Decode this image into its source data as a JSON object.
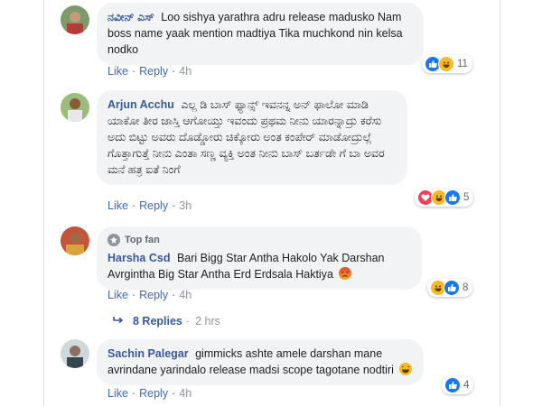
{
  "comments": [
    {
      "name": "ನವೀನ್ ಎಸ್",
      "text": "Loo sishya yarathra adru release madusko Nam boss name yaak mention madtiya Tika muchkond nin kelsa nodko",
      "reaction_count": "11",
      "time": "4h"
    },
    {
      "name": "Arjun Acchu",
      "text": "ಎಲ್ಲ ಡಿ ಬಾಸ್ ಫ್ಯಾನ್ಸ್ ಇವನನ್ನ ಅನ್ ಫಾಲೋ ಮಾಡಿ ಯಾಕೋ ತೀರ ಜಾಸ್ತಿ ಆಗೋಯ್ತು ಇವಂದು ಪ್ರಥಮ ನೀನು ಯಾರನ್ನಾದ್ರು ಕರೆಸು ಅದು ಬಿಟ್ಟು ಅವರು ದೊಡ್ಡೋರು ಚಿಕ್ಕೋರು ಅಂತ ಕಂಪೇರ್ ಮಾಡೋದ್ರುಲ್ಲೆ ಗೊತ್ತಾಗುತ್ತೆ ನೀನು ಎಂತಾ ಸಣ್ಣ ವ್ಯಕ್ತಿ ಅಂತ ನೀನು ಬಾಸ್ ಬರ್ತಡೇ ಗೆ ಬಾ ಅವರ ಮನೆ ಹತ್ರ ಐತೆ ನಿಂಗೆ",
      "reaction_count": "5",
      "time": "3h"
    },
    {
      "badge": "Top fan",
      "name": "Harsha Csd",
      "text": "Bari Bigg Star Antha Hakolo Yak Darshan Avrgintha Big Star Antha Erd Erdsala Haktiya",
      "reaction_count": "8",
      "time": "4h"
    },
    {
      "name": "Sachin Palegar",
      "text": "gimmicks ashte amele darshan mane avrindane yarindalo release madsi scope tagotane nodtiri",
      "reaction_count": "4",
      "time": "4h"
    }
  ],
  "actions": {
    "like": "Like",
    "reply": "Reply",
    "separator": "·"
  },
  "replies": {
    "label": "8 Replies",
    "separator": "·",
    "time": "2 hrs"
  },
  "colors": {
    "name_link": "#385898",
    "action_link": "#4267b2",
    "bubble_bg": "#f2f3f5",
    "like_blue": "#1877f2",
    "haha_yellow": "#f7b928",
    "love_red": "#f33e58"
  },
  "icons": [
    "like-reaction-icon",
    "haha-reaction-icon",
    "love-reaction-icon",
    "angry-emoji-icon",
    "top-fan-badge-icon",
    "reply-arrow-icon"
  ]
}
